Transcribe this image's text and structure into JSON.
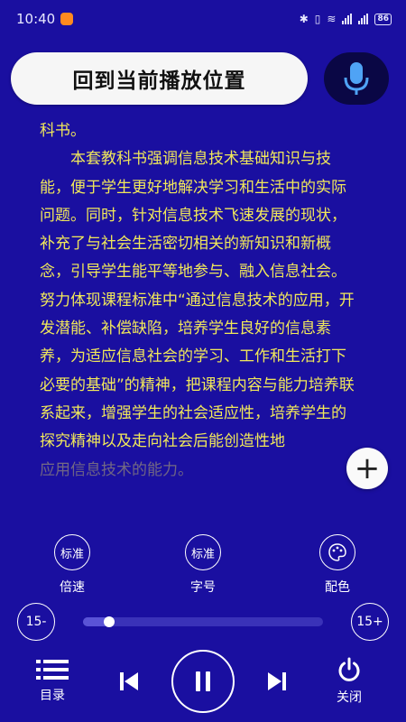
{
  "status": {
    "time": "10:40",
    "battery": "86"
  },
  "header": {
    "return_label": "回到当前播放位置",
    "mic_icon": "microphone-icon"
  },
  "reading": {
    "lines": [
      "科书。",
      "本套教科书强调信息技术基础知识与技能，便于学生更好地解决学习和生活中的实际问题。同时，针对信息技术飞速发展的现状，补充了与社会生活密切相关的新知识和新概念，引导学生能平等地参与、融入信息社会。努力体现课程标准中“通过信息技术的应用，开发潜能、补偿缺陷，培养学生良好的信息素养，为适应信息社会的学习、工作和生活打下必要的基础”的精神，把课程内容与能力培养联系起来，增强学生的社会适应性，培养学生的探究精神以及走向社会后能创造性地",
      "应用信息技术的能力。"
    ],
    "text_color": "#f1e85a"
  },
  "settings": {
    "speed": {
      "value": "标准",
      "label": "倍速"
    },
    "font_size": {
      "value": "标准",
      "label": "字号"
    },
    "color_scheme": {
      "label": "配色",
      "icon": "palette-icon"
    }
  },
  "progress": {
    "back_label": "15-",
    "forward_label": "15+",
    "fraction": 0.11
  },
  "controls": {
    "catalog_label": "目录",
    "close_label": "关闭",
    "state": "playing"
  },
  "colors": {
    "background": "#1a0fa0",
    "reading_text": "#f1e85a",
    "mic_bg": "#0a0745",
    "mic_icon": "#4fa3f5"
  }
}
